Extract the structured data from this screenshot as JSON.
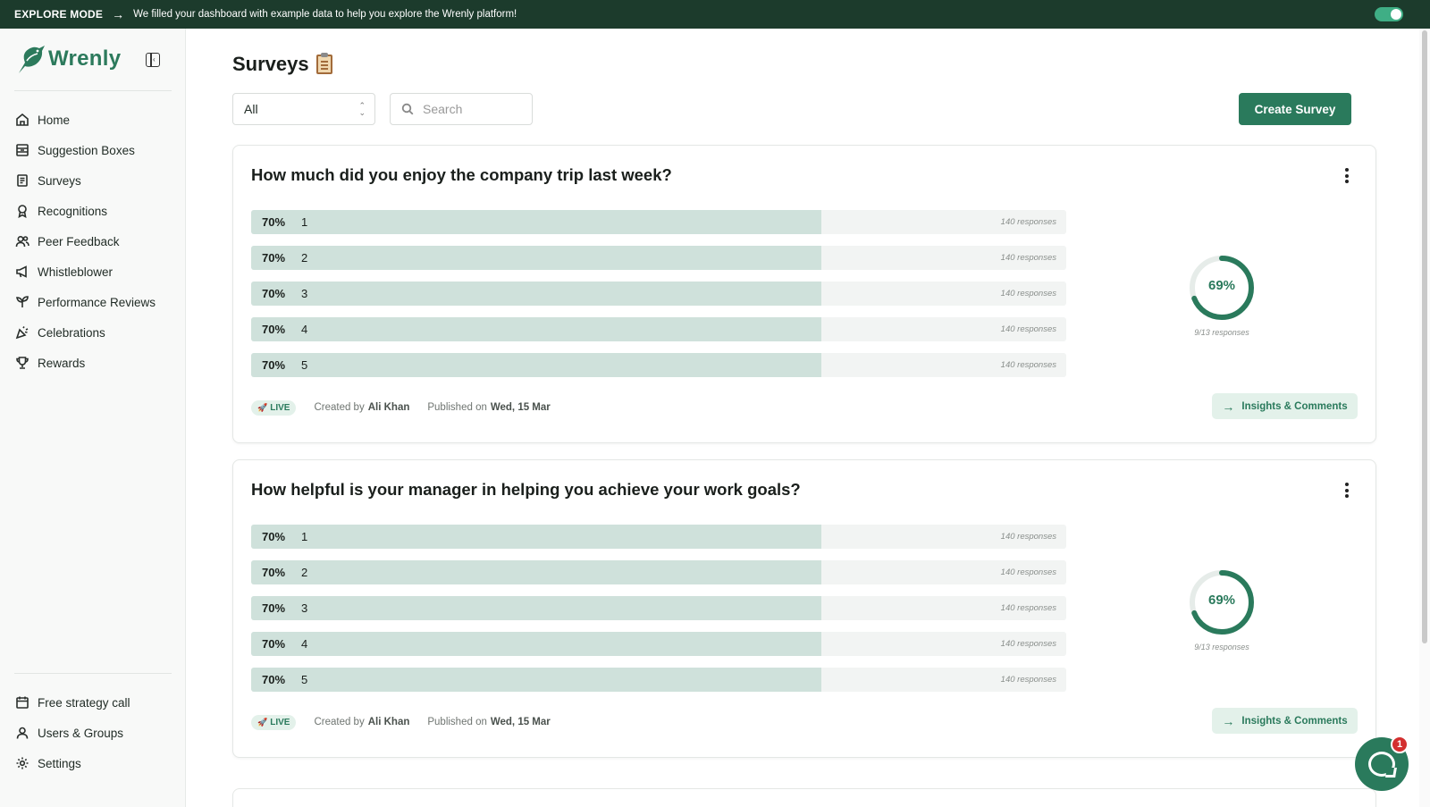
{
  "banner": {
    "mode": "EXPLORE MODE",
    "message": "We filled your dashboard with example data to help you explore the Wrenly platform!",
    "toggle_on": true
  },
  "brand": {
    "name": "Wrenly",
    "color": "#2c7a5c"
  },
  "sidebar": {
    "items": [
      {
        "label": "Home",
        "icon": "home-icon"
      },
      {
        "label": "Suggestion Boxes",
        "icon": "inbox-icon"
      },
      {
        "label": "Surveys",
        "icon": "survey-icon"
      },
      {
        "label": "Recognitions",
        "icon": "award-icon"
      },
      {
        "label": "Peer Feedback",
        "icon": "users-icon"
      },
      {
        "label": "Whistleblower",
        "icon": "megaphone-icon"
      },
      {
        "label": "Performance Reviews",
        "icon": "sprout-icon"
      },
      {
        "label": "Celebrations",
        "icon": "party-icon"
      },
      {
        "label": "Rewards",
        "icon": "trophy-icon"
      }
    ],
    "bottom_items": [
      {
        "label": "Free strategy call",
        "icon": "calendar-icon"
      },
      {
        "label": "Users & Groups",
        "icon": "user-icon"
      },
      {
        "label": "Settings",
        "icon": "gear-icon"
      }
    ]
  },
  "page": {
    "title": "Surveys",
    "filter_value": "All",
    "search_placeholder": "Search",
    "create_label": "Create Survey"
  },
  "surveys": [
    {
      "title": "How much did you enjoy the company trip last week?",
      "options": [
        {
          "pct": "70%",
          "label": "1",
          "fill": 0.7,
          "responses": "140 responses"
        },
        {
          "pct": "70%",
          "label": "2",
          "fill": 0.7,
          "responses": "140 responses"
        },
        {
          "pct": "70%",
          "label": "3",
          "fill": 0.7,
          "responses": "140 responses"
        },
        {
          "pct": "70%",
          "label": "4",
          "fill": 0.7,
          "responses": "140 responses"
        },
        {
          "pct": "70%",
          "label": "5",
          "fill": 0.7,
          "responses": "140 responses"
        }
      ],
      "completion_text": "69%",
      "completion": 0.69,
      "completion_sub": "9/13 responses",
      "status": "LIVE",
      "created_label": "Created by",
      "created_by": "Ali Khan",
      "published_label": "Published on",
      "published_on": "Wed, 15 Mar",
      "insights_label": "Insights & Comments"
    },
    {
      "title": "How helpful is your manager in helping you achieve your work goals?",
      "options": [
        {
          "pct": "70%",
          "label": "1",
          "fill": 0.7,
          "responses": "140 responses"
        },
        {
          "pct": "70%",
          "label": "2",
          "fill": 0.7,
          "responses": "140 responses"
        },
        {
          "pct": "70%",
          "label": "3",
          "fill": 0.7,
          "responses": "140 responses"
        },
        {
          "pct": "70%",
          "label": "4",
          "fill": 0.7,
          "responses": "140 responses"
        },
        {
          "pct": "70%",
          "label": "5",
          "fill": 0.7,
          "responses": "140 responses"
        }
      ],
      "completion_text": "69%",
      "completion": 0.69,
      "completion_sub": "9/13 responses",
      "status": "LIVE",
      "created_label": "Created by",
      "created_by": "Ali Khan",
      "published_label": "Published on",
      "published_on": "Wed, 15 Mar",
      "insights_label": "Insights & Comments"
    }
  ],
  "chat": {
    "badge_count": "1"
  },
  "colors": {
    "accent": "#2a7a5c",
    "banner": "#1c3b2c",
    "bar_fill": "#cfe1db",
    "badge": "#d32f2f"
  }
}
